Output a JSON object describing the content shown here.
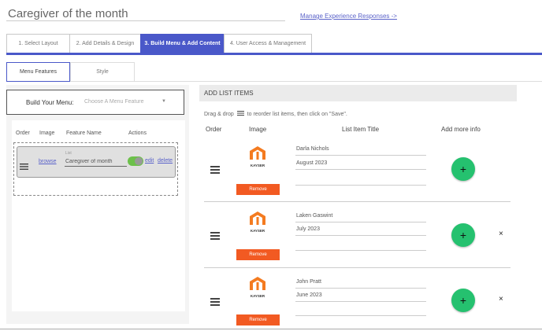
{
  "header": {
    "title": "Caregiver of the month",
    "manage_link": "Manage Experience Responses ->"
  },
  "steps": [
    {
      "label": "1. Select Layout"
    },
    {
      "label": "2. Add Details & Design"
    },
    {
      "label": "3. Build Menu & Add Content"
    },
    {
      "label": "4. User Access & Management"
    }
  ],
  "subtabs": [
    {
      "label": "Menu Features"
    },
    {
      "label": "Style"
    }
  ],
  "build_menu": {
    "label": "Build Your Menu:",
    "select_placeholder": "Choose A Menu Feature",
    "caret": "▼"
  },
  "features_table": {
    "headers": [
      "Order",
      "Image",
      "Feature Name",
      "Actions"
    ],
    "row": {
      "image_link": "browse",
      "list_label": "List",
      "name": "Caregiver of month",
      "edit": "edit",
      "delete": "delete"
    }
  },
  "list_items": {
    "section_title": "ADD LIST ITEMS",
    "instructions_before": "Drag & drop",
    "instructions_after": "to reorder list items, then click on \"Save\".",
    "headers": [
      "Order",
      "Image",
      "List Item Title",
      "Add more info"
    ],
    "remove_label": "Remove",
    "logo_text": "KAYSER",
    "plus_label": "+",
    "close_label": "×",
    "items": [
      {
        "name": "Darla Nichols",
        "month": "August 2023",
        "show_close": false
      },
      {
        "name": "Laken Gaswint",
        "month": "July 2023",
        "show_close": true
      },
      {
        "name": "John Pratt",
        "month": "June 2023",
        "show_close": true
      }
    ]
  },
  "colors": {
    "accent": "#4a58c9",
    "remove": "#f25a22",
    "add": "#25c16f",
    "logo": "#f47b20",
    "toggle": "#6cc04a"
  }
}
